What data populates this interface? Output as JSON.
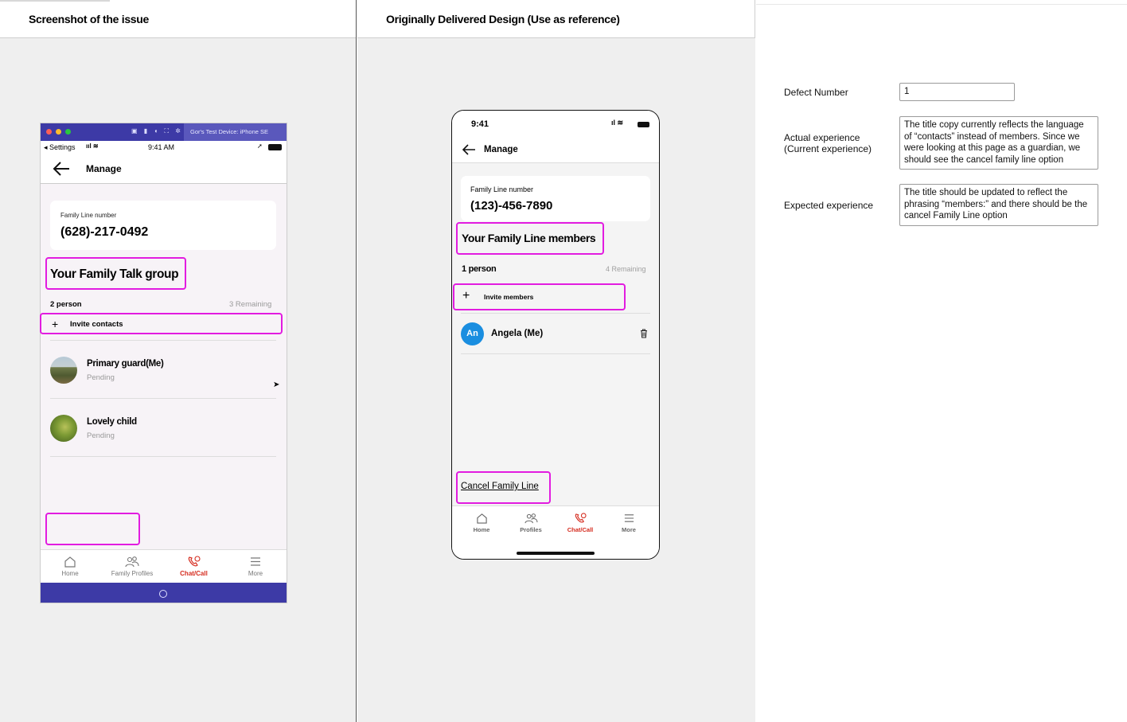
{
  "left_panel": {
    "title": "Screenshot of the issue",
    "phone": {
      "mac_bar_title": "Gor's Test Device: iPhone SE",
      "status": {
        "back_label": "◂ Settings",
        "time": "9:41 AM"
      },
      "header_title": "Manage",
      "family_line_label": "Family Line number",
      "family_line_number": "(628)-217-0492",
      "group_title": "Your Family Talk group",
      "count": "2 person",
      "remaining": "3 Remaining",
      "invite_label": "Invite contacts",
      "members": [
        {
          "name": "Primary guard(Me)",
          "status": "Pending"
        },
        {
          "name": "Lovely child",
          "status": "Pending"
        }
      ],
      "tabs": [
        "Home",
        "Family Profiles",
        "Chat/Call",
        "More"
      ]
    }
  },
  "middle_panel": {
    "title": "Originally Delivered Design (Use as reference)",
    "phone": {
      "time": "9:41",
      "header_title": "Manage",
      "family_line_label": "Family Line number",
      "family_line_number": "(123)-456-7890",
      "group_title": "Your Family Line members",
      "count": "1 person",
      "remaining": "4 Remaining",
      "invite_label": "Invite members",
      "member": {
        "initials": "An",
        "name": "Angela (Me)"
      },
      "cancel_link": "Cancel Family Line",
      "tabs": [
        "Home",
        "Profiles",
        "Chat/Call",
        "More"
      ]
    }
  },
  "right_panel": {
    "defect_number_label": "Defect Number",
    "defect_number_value": "1",
    "actual_label_1": "Actual experience",
    "actual_label_2": "(Current experience)",
    "actual_text": "The title copy currently reflects the language of “contacts” instead of members. Since we were looking at this page as a guardian, we should see the cancel family line option",
    "expected_label": "Expected experience",
    "expected_text": "The title should be updated to reflect the phrasing “members:” and there should be the cancel Family Line option"
  },
  "colors": {
    "highlight": "#e21ce0",
    "brand_red": "#d52b1e",
    "frame_purple": "#3d3aa6",
    "avatar_blue": "#1a8ee0"
  }
}
